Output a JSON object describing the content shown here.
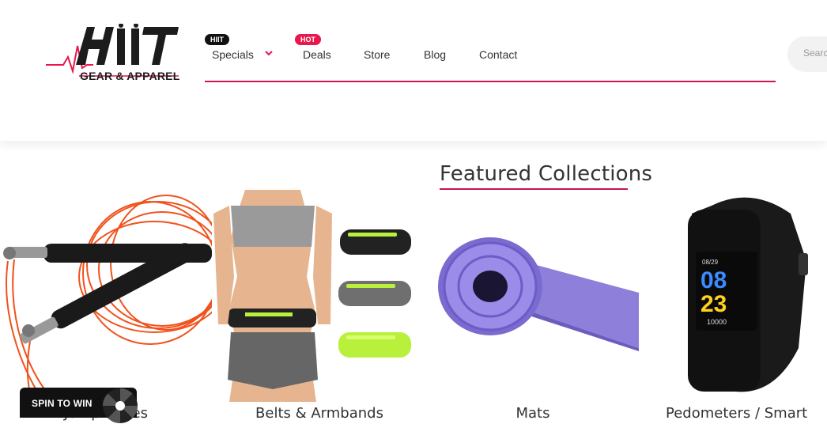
{
  "brand": {
    "logo_text": "HIIT",
    "tagline": "GEAR & APPAREL"
  },
  "nav": {
    "items": [
      {
        "label": "Specials",
        "badge": "HIIT",
        "has_dropdown": true
      },
      {
        "label": "Deals",
        "badge": "HOT"
      },
      {
        "label": "Store"
      },
      {
        "label": "Blog"
      },
      {
        "label": "Contact"
      }
    ]
  },
  "search": {
    "placeholder": "Search"
  },
  "section": {
    "title": "Featured Collections"
  },
  "products": [
    {
      "label": "Jump Ropes"
    },
    {
      "label": "Belts & Armbands"
    },
    {
      "label": "Mats"
    },
    {
      "label": "Pedometers / Smart"
    }
  ],
  "spin": {
    "label": "SPIN TO WIN"
  },
  "colors": {
    "accent": "#c8174d",
    "hot_badge": "#e8174d",
    "dark": "#111111"
  }
}
